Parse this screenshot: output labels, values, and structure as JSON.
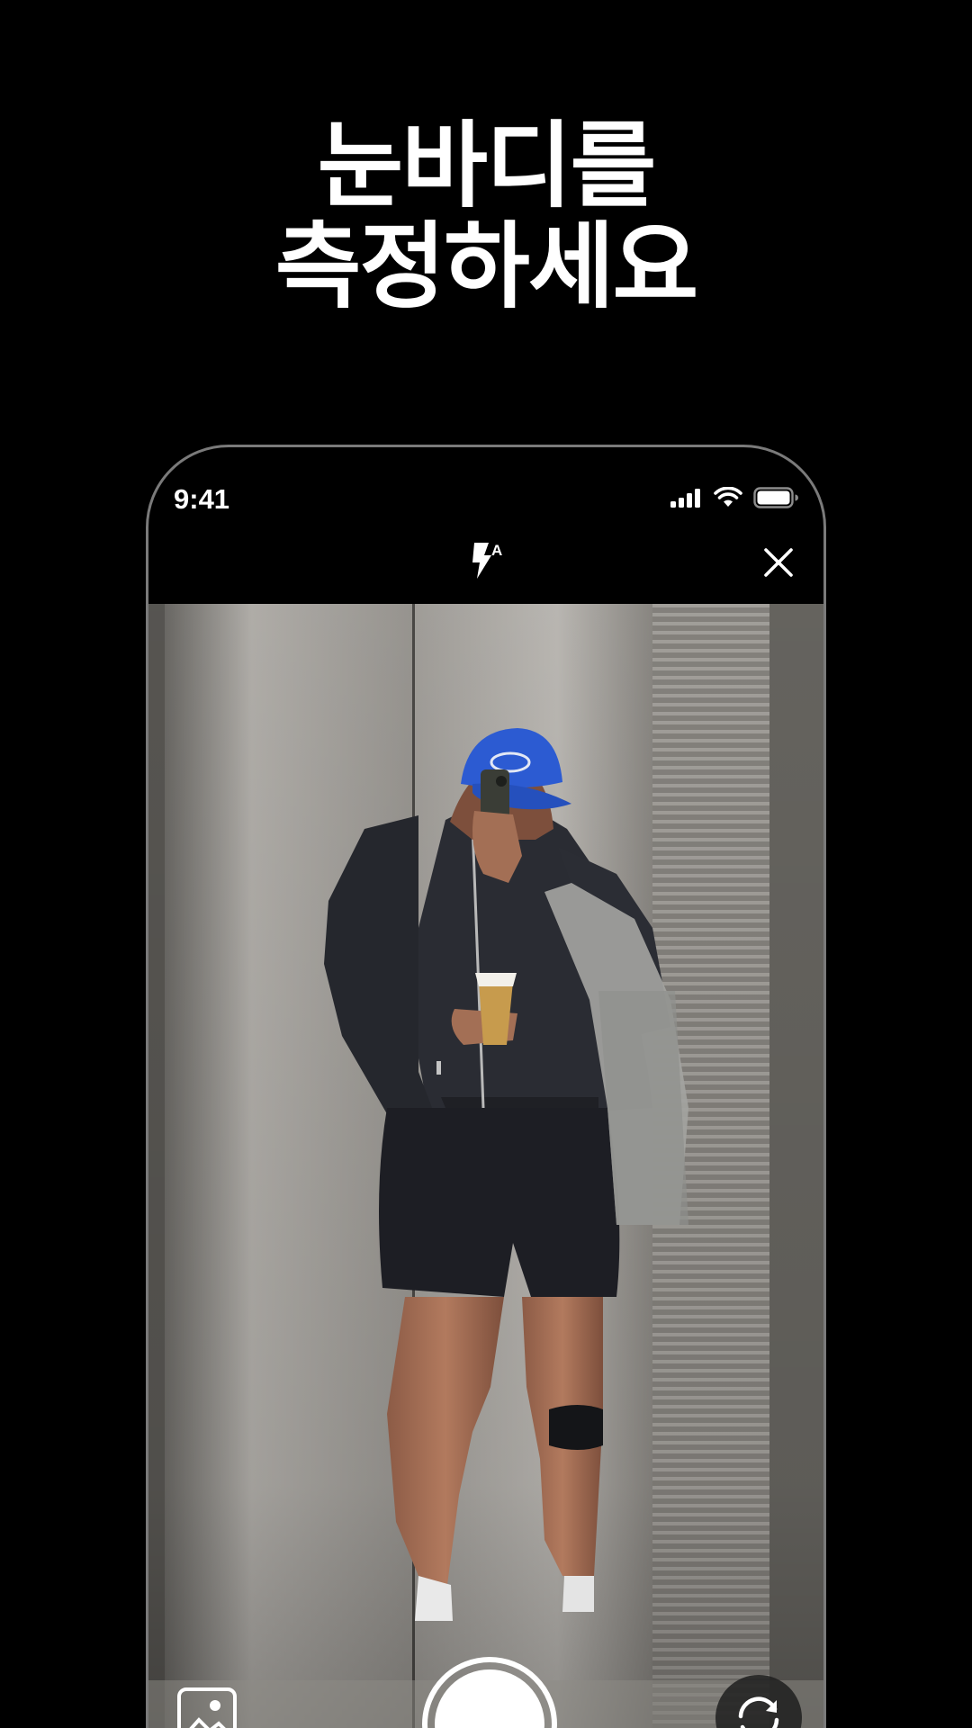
{
  "headline": {
    "line1": "눈바디를",
    "line2": "측정하세요"
  },
  "status_bar": {
    "time": "9:41",
    "icons": [
      "cellular-signal-icon",
      "wifi-icon",
      "battery-icon"
    ]
  },
  "camera_toolbar": {
    "flash_icon": "flash-auto-icon",
    "flash_mode_letter": "A",
    "close_icon": "close-icon"
  },
  "camera_controls": {
    "gallery_icon": "gallery-icon",
    "shutter_icon": "shutter-icon",
    "switch_camera_icon": "switch-camera-icon"
  },
  "colors": {
    "background": "#000000",
    "text": "#ffffff",
    "frame_border": "#7a7a7a"
  }
}
